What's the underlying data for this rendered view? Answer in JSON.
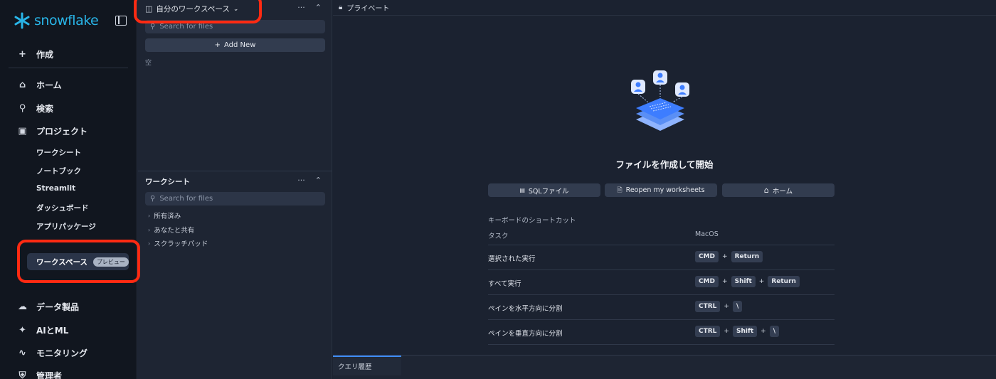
{
  "nav": {
    "logo_text": "snowflake",
    "create": "作成",
    "items": [
      "ホーム",
      "検索",
      "プロジェクト"
    ],
    "subitems": [
      "ワークシート",
      "ノートブック",
      "Streamlit",
      "ダッシュボード",
      "アプリパッケージ"
    ],
    "workspace": {
      "label": "ワークスペース",
      "badge": "プレビュー"
    },
    "bottom_items": [
      "データ製品",
      "AIとML",
      "モニタリング",
      "管理者"
    ]
  },
  "files": {
    "workspace_title": "自分のワークスペース",
    "search_placeholder": "Search for files",
    "add_new": "Add New",
    "empty_label": "空",
    "worksheets_title": "ワークシート",
    "tree": [
      "所有済み",
      "あなたと共有",
      "スクラッチパッド"
    ],
    "more": "···",
    "collapse": "⌃"
  },
  "main": {
    "private_label": "プライベート",
    "headline": "ファイルを作成して開始",
    "buttons": {
      "sql": "SQLファイル",
      "reopen": "Reopen my worksheets",
      "home": "ホーム"
    },
    "shortcuts_title": "キーボードのショートカット",
    "col_task": "タスク",
    "col_os": "MacOS",
    "shortcuts": [
      {
        "task": "選択された実行",
        "k1": "CMD",
        "k2": "Return"
      },
      {
        "task": "すべて実行",
        "k1": "CMD",
        "k2": "Shift",
        "k3": "Return"
      },
      {
        "task": "ペインを水平方向に分割",
        "k1": "CTRL",
        "k2": "\\"
      },
      {
        "task": "ペインを垂直方向に分割",
        "k1": "CTRL",
        "k2": "Shift",
        "k3": "\\"
      }
    ],
    "plus": "+",
    "bottom_tab": "クエリ履歴"
  },
  "colors": {
    "brand": "#29b5e8",
    "highlight": "#ff2a12",
    "accent": "#3d8cff"
  }
}
